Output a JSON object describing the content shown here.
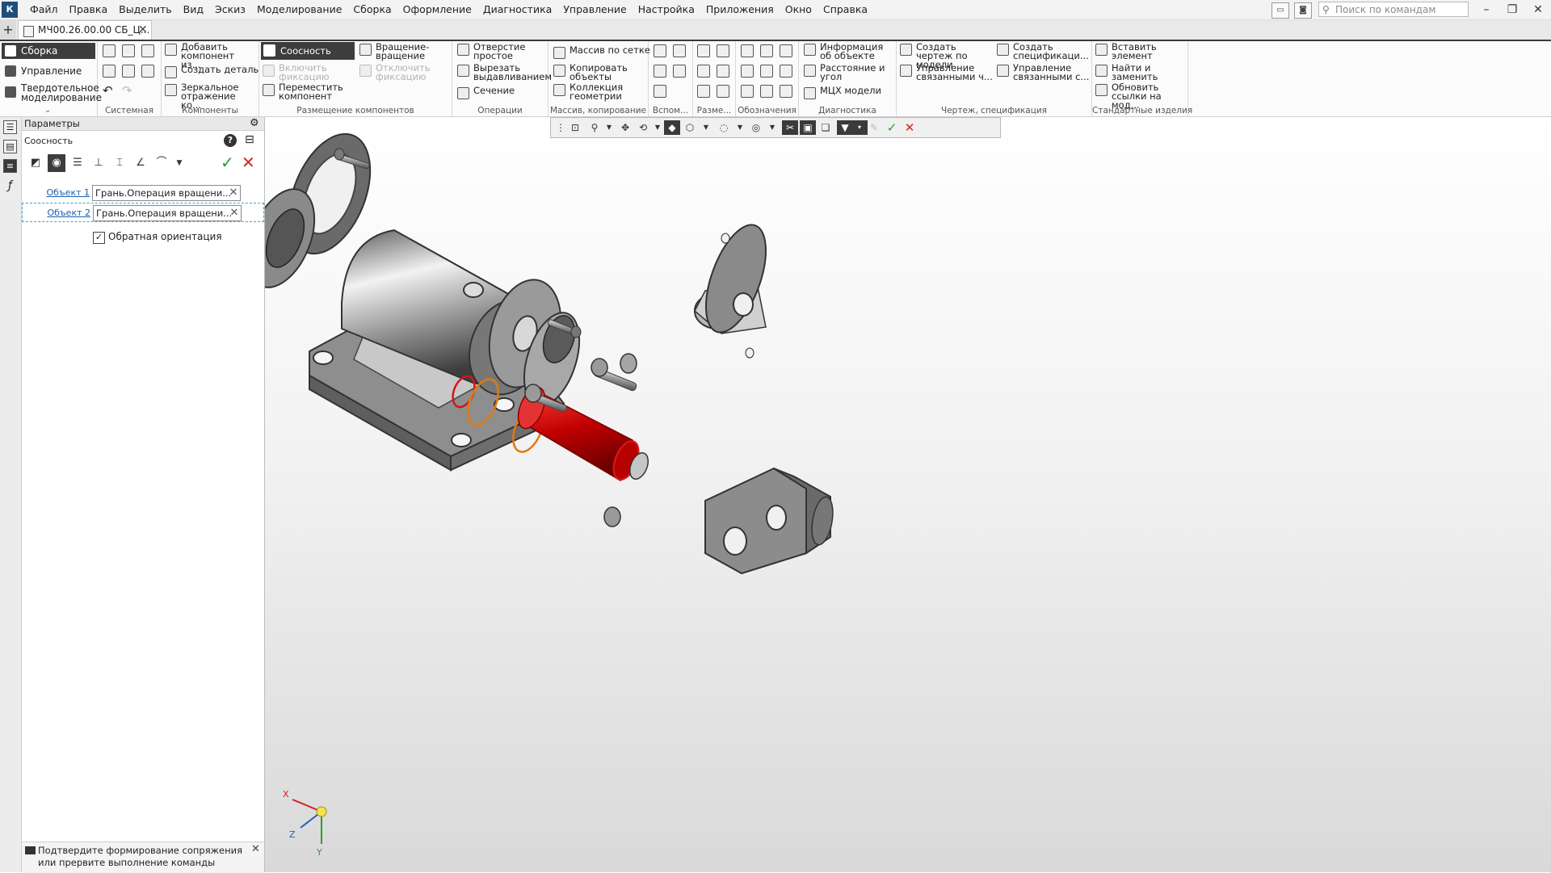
{
  "menu": {
    "logo": "К",
    "items": [
      "Файл",
      "Правка",
      "Выделить",
      "Вид",
      "Эскиз",
      "Моделирование",
      "Сборка",
      "Оформление",
      "Диагностика",
      "Управление",
      "Настройка",
      "Приложения",
      "Окно",
      "Справка"
    ],
    "search_placeholder": "Поиск по командам (Alt+/)"
  },
  "tab": {
    "title": "МЧ00.26.00.00 СБ_Ц..."
  },
  "modes": [
    "Сборка",
    "Управление",
    "Твердотельное моделирование"
  ],
  "ribbon": {
    "groups": {
      "system": "Системная",
      "components": "Компоненты",
      "placement": "Размещение компонентов",
      "operations": "Операции",
      "array": "Массив, копирование",
      "aux": "Вспом...",
      "dims": "Разме...",
      "notation": "Обозначения",
      "diagnostics": "Диагностика",
      "drawing": "Чертеж, спецификация",
      "std": "Стандартные изделия"
    },
    "buttons": {
      "add_component": "Добавить компонент из...",
      "create_part": "Создать деталь",
      "mirror": "Зеркальное отражение ко...",
      "coaxial": "Соосность",
      "enable_fix": "Включить фиксацию",
      "move_component": "Переместить компонент",
      "rotate": "Вращение-вращение",
      "disable_fix": "Отключить фиксацию",
      "hole": "Отверстие простое",
      "cut_extrude": "Вырезать выдавливанием",
      "section": "Сечение",
      "grid_array": "Массив по сетке",
      "copy_objects": "Копировать объекты",
      "geometry_collection": "Коллекция геометрии",
      "object_info": "Информация об объекте",
      "distance_angle": "Расстояние и угол",
      "mcc": "МЦХ модели",
      "create_drawing": "Создать чертеж по модели",
      "manage_linked": "Управление связанными ч...",
      "create_spec": "Создать спецификаци...",
      "manage_linked_spec": "Управление связанными с...",
      "insert_element": "Вставить элемент",
      "find_replace": "Найти и заменить",
      "update_links": "Обновить ссылки на мод..."
    }
  },
  "params": {
    "header": "Параметры",
    "subtitle": "Соосность",
    "object1_label": "Объект 1",
    "object1_value": "Грань.Операция вращени...",
    "object2_label": "Объект 2",
    "object2_value": "Грань.Операция вращени...",
    "reverse_label": "Обратная ориентация",
    "reverse_checked": true,
    "status": "Подтвердите формирование сопряжения или прервите выполнение команды"
  },
  "triad": {
    "x": "X",
    "y": "Y",
    "z": "Z"
  },
  "colors": {
    "selected_face": "#c00000",
    "highlight_ring": "#e07a10",
    "highlight_red": "#d01818",
    "ok": "#2a9d2a",
    "cancel": "#d02525"
  }
}
